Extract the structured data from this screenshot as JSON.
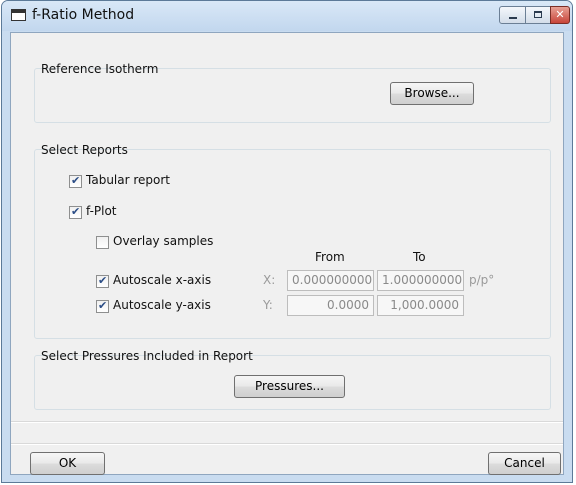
{
  "window": {
    "title": "f-Ratio Method"
  },
  "reference_isotherm": {
    "title": "Reference Isotherm",
    "browse_label": "Browse..."
  },
  "select_reports": {
    "title": "Select Reports",
    "tabular_report": {
      "label": "Tabular report",
      "checked": true
    },
    "f_plot": {
      "label": "f-Plot",
      "checked": true
    },
    "overlay_samples": {
      "label": "Overlay samples",
      "checked": false
    },
    "from_header": "From",
    "to_header": "To",
    "autoscale_x": {
      "label": "Autoscale x-axis",
      "checked": true,
      "axis_prefix": "X:",
      "from": "0.000000000",
      "to": "1.000000000",
      "unit": "p/p°"
    },
    "autoscale_y": {
      "label": "Autoscale y-axis",
      "checked": true,
      "axis_prefix": "Y:",
      "from": "0.0000",
      "to": "1,000.0000"
    }
  },
  "pressures": {
    "title": "Select Pressures Included in Report",
    "button_label": "Pressures..."
  },
  "footer": {
    "ok_label": "OK",
    "cancel_label": "Cancel"
  },
  "icons": {
    "app": "window-app-icon",
    "minimize": "minimize-icon",
    "maximize": "maximize-icon",
    "close": "close-icon"
  },
  "colors": {
    "titlebar": "#c9dcf0",
    "close_button": "#c8453a",
    "client": "#f0f0f0"
  }
}
